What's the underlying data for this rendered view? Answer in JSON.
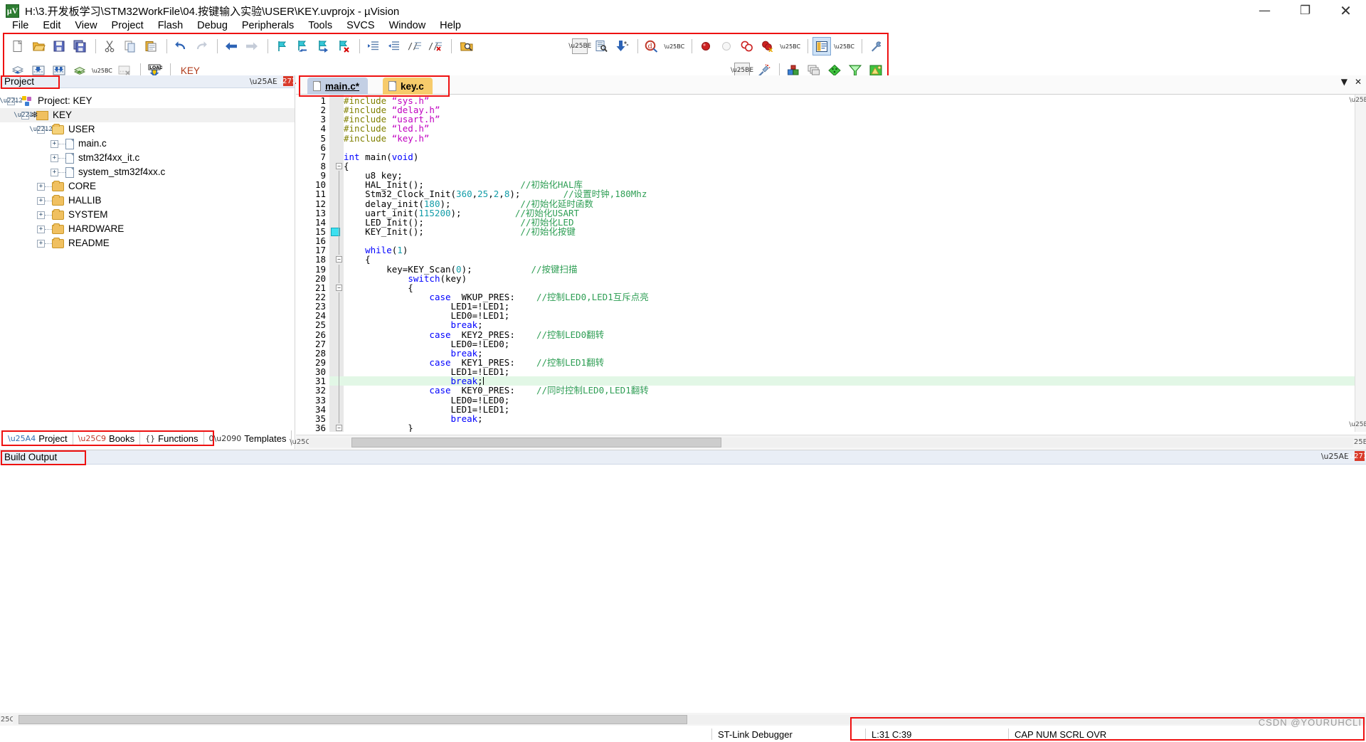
{
  "window": {
    "title": "H:\\3.开发板学习\\STM32WorkFile\\04.按键输入实验\\USER\\KEY.uvprojx - µVision",
    "app_icon": "uvision-logo-icon",
    "controls": {
      "minimize": "—",
      "maximize": "❐",
      "close": "✕"
    }
  },
  "menu": {
    "items": [
      {
        "label": "File"
      },
      {
        "label": "Edit"
      },
      {
        "label": "View"
      },
      {
        "label": "Project"
      },
      {
        "label": "Flash"
      },
      {
        "label": "Debug"
      },
      {
        "label": "Peripherals"
      },
      {
        "label": "Tools"
      },
      {
        "label": "SVCS"
      },
      {
        "label": "Window"
      },
      {
        "label": "Help"
      }
    ]
  },
  "toolbar": {
    "row1": [
      {
        "name": "new-file-icon",
        "tip": "New"
      },
      {
        "name": "open-file-icon",
        "tip": "Open"
      },
      {
        "name": "save-icon",
        "tip": "Save"
      },
      {
        "name": "save-all-icon",
        "tip": "Save All"
      },
      {
        "name": "cut-icon",
        "tip": "Cut"
      },
      {
        "name": "copy-icon",
        "tip": "Copy"
      },
      {
        "name": "paste-icon",
        "tip": "Paste"
      },
      {
        "name": "undo-icon",
        "tip": "Undo"
      },
      {
        "name": "redo-icon",
        "tip": "Redo"
      },
      {
        "name": "navigate-back-icon",
        "tip": "Back"
      },
      {
        "name": "navigate-forward-icon",
        "tip": "Forward"
      },
      {
        "name": "bookmark-toggle-icon",
        "tip": "Insert/Remove Bookmark"
      },
      {
        "name": "bookmark-prev-icon",
        "tip": "Previous Bookmark"
      },
      {
        "name": "bookmark-next-icon",
        "tip": "Next Bookmark"
      },
      {
        "name": "bookmark-clear-icon",
        "tip": "Clear All Bookmarks"
      },
      {
        "name": "indent-right-icon",
        "tip": "Indent"
      },
      {
        "name": "indent-left-icon",
        "tip": "Outdent"
      },
      {
        "name": "comment-icon",
        "tip": "Comment Selection"
      },
      {
        "name": "uncomment-icon",
        "tip": "Uncomment Selection"
      },
      {
        "name": "find-in-files-icon",
        "tip": "Find in Files"
      },
      {
        "name": "combo-dropdown",
        "tip": "Search text"
      },
      {
        "name": "find-icon",
        "tip": "Find"
      },
      {
        "name": "incremental-find-icon",
        "tip": "Incremental Find"
      },
      {
        "name": "browse-symbol-icon",
        "tip": "Browse Symbol"
      },
      {
        "name": "breakpoint-insert-icon",
        "tip": "Insert/Remove Breakpoint"
      },
      {
        "name": "breakpoint-disable-icon",
        "tip": "Enable/Disable Breakpoint"
      },
      {
        "name": "breakpoint-disable-all-icon",
        "tip": "Disable All Breakpoints"
      },
      {
        "name": "breakpoint-kill-all-icon",
        "tip": "Kill All Breakpoints"
      },
      {
        "name": "window-layout-icon",
        "tip": "Configure Windows",
        "selected": true
      },
      {
        "name": "configure-target-icon",
        "tip": "Configuration Wizard"
      }
    ],
    "row2": [
      {
        "name": "build-icon",
        "tip": "Translate"
      },
      {
        "name": "build-target-icon",
        "tip": "Build"
      },
      {
        "name": "rebuild-all-icon",
        "tip": "Rebuild"
      },
      {
        "name": "batch-build-icon",
        "tip": "Batch Build"
      },
      {
        "name": "stop-build-icon",
        "tip": "Stop Build"
      },
      {
        "name": "download-icon",
        "tip": "Download (LOAD)"
      },
      {
        "name": "target-select-combo",
        "tip": "Select Target"
      },
      {
        "name": "target-options-icon",
        "tip": "Options for Target"
      },
      {
        "name": "manage-project-items-icon",
        "tip": "Manage Project Items"
      },
      {
        "name": "multi-project-icon",
        "tip": "Manage Multi-Project Workspace"
      },
      {
        "name": "pack-installer-icon",
        "tip": "Pack Installer"
      },
      {
        "name": "svcs-icon",
        "tip": "Software Packs Filter"
      },
      {
        "name": "manage-run-time-env-icon",
        "tip": "Manage Run-Time Environment"
      }
    ],
    "download_label": "LOAD",
    "target_value": "KEY"
  },
  "project_panel": {
    "title": "Project",
    "pin_icon": "pin-icon",
    "close_icon": "close-icon",
    "tree": [
      {
        "indent": 0,
        "expander": "-",
        "icon": "project-icon",
        "label": "Project: KEY",
        "selected": false
      },
      {
        "indent": 1,
        "expander": "-",
        "icon": "target-icon",
        "label": "KEY",
        "selected": true
      },
      {
        "indent": 2,
        "expander": "-",
        "icon": "folder-open-icon",
        "label": "USER",
        "selected": false
      },
      {
        "indent": 3,
        "expander": "+",
        "icon": "file-icon",
        "label": "main.c",
        "selected": false
      },
      {
        "indent": 3,
        "expander": "+",
        "icon": "file-icon",
        "label": "stm32f4xx_it.c",
        "selected": false
      },
      {
        "indent": 3,
        "expander": "+",
        "icon": "file-icon",
        "label": "system_stm32f4xx.c",
        "selected": false
      },
      {
        "indent": 2,
        "expander": "+",
        "icon": "folder-icon",
        "label": "CORE",
        "selected": false
      },
      {
        "indent": 2,
        "expander": "+",
        "icon": "folder-icon",
        "label": "HALLIB",
        "selected": false
      },
      {
        "indent": 2,
        "expander": "+",
        "icon": "folder-icon",
        "label": "SYSTEM",
        "selected": false
      },
      {
        "indent": 2,
        "expander": "+",
        "icon": "folder-icon",
        "label": "HARDWARE",
        "selected": false
      },
      {
        "indent": 2,
        "expander": "+",
        "icon": "folder-icon",
        "label": "README",
        "selected": false
      }
    ],
    "tabs": [
      {
        "label": "Project",
        "icon": "project-tab-icon",
        "active": true
      },
      {
        "label": "Books",
        "icon": "books-icon",
        "active": false
      },
      {
        "label": "Functions",
        "icon": "functions-braces-icon",
        "active": false
      },
      {
        "label": "Templates",
        "icon": "templates-icon",
        "active": false
      }
    ]
  },
  "editor": {
    "tabs": [
      {
        "label": "main.c*",
        "active": true,
        "icon": "file-icon"
      },
      {
        "label": "key.c",
        "active": false,
        "icon": "file-icon"
      }
    ],
    "first_line": 1,
    "last_line": 36,
    "highlight_line": 31,
    "breakpoint_line": 15,
    "fold_lines": [
      8,
      18,
      21,
      36
    ],
    "lines": [
      {
        "n": 1,
        "tokens": [
          {
            "t": "#include ",
            "c": "pp"
          },
          {
            "t": "“sys.h”",
            "c": "st"
          }
        ]
      },
      {
        "n": 2,
        "tokens": [
          {
            "t": "#include ",
            "c": "pp"
          },
          {
            "t": "“delay.h”",
            "c": "st"
          }
        ]
      },
      {
        "n": 3,
        "tokens": [
          {
            "t": "#include ",
            "c": "pp"
          },
          {
            "t": "“usart.h”",
            "c": "st"
          }
        ]
      },
      {
        "n": 4,
        "tokens": [
          {
            "t": "#include ",
            "c": "pp"
          },
          {
            "t": "“led.h”",
            "c": "st"
          }
        ]
      },
      {
        "n": 5,
        "tokens": [
          {
            "t": "#include ",
            "c": "pp"
          },
          {
            "t": "“key.h”",
            "c": "st"
          }
        ]
      },
      {
        "n": 6,
        "tokens": []
      },
      {
        "n": 7,
        "tokens": [
          {
            "t": "int",
            "c": "k"
          },
          {
            "t": " main(",
            "c": ""
          },
          {
            "t": "void",
            "c": "k"
          },
          {
            "t": ")",
            "c": ""
          }
        ]
      },
      {
        "n": 8,
        "tokens": [
          {
            "t": "{",
            "c": ""
          }
        ]
      },
      {
        "n": 9,
        "tokens": [
          {
            "t": "    u8 key;",
            "c": ""
          }
        ]
      },
      {
        "n": 10,
        "tokens": [
          {
            "t": "    HAL_Init();",
            "c": ""
          },
          {
            "t": "                  ",
            "c": ""
          },
          {
            "t": "//初始化HAL库",
            "c": "cm"
          }
        ]
      },
      {
        "n": 11,
        "tokens": [
          {
            "t": "    Stm32_Clock_Init(",
            "c": ""
          },
          {
            "t": "360",
            "c": "nu"
          },
          {
            "t": ",",
            "c": ""
          },
          {
            "t": "25",
            "c": "nu"
          },
          {
            "t": ",",
            "c": ""
          },
          {
            "t": "2",
            "c": "nu"
          },
          {
            "t": ",",
            "c": ""
          },
          {
            "t": "8",
            "c": "nu"
          },
          {
            "t": ");",
            "c": ""
          },
          {
            "t": "        ",
            "c": ""
          },
          {
            "t": "//设置时钟,180Mhz",
            "c": "cm"
          }
        ]
      },
      {
        "n": 12,
        "tokens": [
          {
            "t": "    delay_init(",
            "c": ""
          },
          {
            "t": "180",
            "c": "nu"
          },
          {
            "t": ");",
            "c": ""
          },
          {
            "t": "             ",
            "c": ""
          },
          {
            "t": "//初始化延时函数",
            "c": "cm"
          }
        ]
      },
      {
        "n": 13,
        "tokens": [
          {
            "t": "    uart_init(",
            "c": ""
          },
          {
            "t": "115200",
            "c": "nu"
          },
          {
            "t": ");",
            "c": ""
          },
          {
            "t": "          ",
            "c": ""
          },
          {
            "t": "//初始化USART",
            "c": "cm"
          }
        ]
      },
      {
        "n": 14,
        "tokens": [
          {
            "t": "    LED_Init();",
            "c": ""
          },
          {
            "t": "                  ",
            "c": ""
          },
          {
            "t": "//初始化LED",
            "c": "cm"
          }
        ]
      },
      {
        "n": 15,
        "tokens": [
          {
            "t": "    KEY_Init();",
            "c": ""
          },
          {
            "t": "                  ",
            "c": ""
          },
          {
            "t": "//初始化按键",
            "c": "cm"
          }
        ]
      },
      {
        "n": 16,
        "tokens": []
      },
      {
        "n": 17,
        "tokens": [
          {
            "t": "    ",
            "c": ""
          },
          {
            "t": "while",
            "c": "k"
          },
          {
            "t": "(",
            "c": ""
          },
          {
            "t": "1",
            "c": "nu"
          },
          {
            "t": ")",
            "c": ""
          }
        ]
      },
      {
        "n": 18,
        "tokens": [
          {
            "t": "    {",
            "c": ""
          }
        ]
      },
      {
        "n": 19,
        "tokens": [
          {
            "t": "        key=KEY_Scan(",
            "c": ""
          },
          {
            "t": "0",
            "c": "nu"
          },
          {
            "t": ");",
            "c": ""
          },
          {
            "t": "           ",
            "c": ""
          },
          {
            "t": "//按键扫描",
            "c": "cm"
          }
        ]
      },
      {
        "n": 20,
        "tokens": [
          {
            "t": "            ",
            "c": ""
          },
          {
            "t": "switch",
            "c": "k"
          },
          {
            "t": "(key)",
            "c": ""
          }
        ]
      },
      {
        "n": 21,
        "tokens": [
          {
            "t": "            {",
            "c": ""
          }
        ]
      },
      {
        "n": 22,
        "tokens": [
          {
            "t": "                ",
            "c": ""
          },
          {
            "t": "case",
            "c": "k"
          },
          {
            "t": "  WKUP_PRES:    ",
            "c": ""
          },
          {
            "t": "//控制LED0,LED1互斥点亮",
            "c": "cm"
          }
        ]
      },
      {
        "n": 23,
        "tokens": [
          {
            "t": "                    LED1=!LED1;",
            "c": ""
          }
        ]
      },
      {
        "n": 24,
        "tokens": [
          {
            "t": "                    LED0=!LED1;",
            "c": ""
          }
        ]
      },
      {
        "n": 25,
        "tokens": [
          {
            "t": "                    ",
            "c": ""
          },
          {
            "t": "break",
            "c": "k"
          },
          {
            "t": ";",
            "c": ""
          }
        ]
      },
      {
        "n": 26,
        "tokens": [
          {
            "t": "                ",
            "c": ""
          },
          {
            "t": "case",
            "c": "k"
          },
          {
            "t": "  KEY2_PRES:    ",
            "c": ""
          },
          {
            "t": "//控制LED0翻转",
            "c": "cm"
          }
        ]
      },
      {
        "n": 27,
        "tokens": [
          {
            "t": "                    LED0=!LED0;",
            "c": ""
          }
        ]
      },
      {
        "n": 28,
        "tokens": [
          {
            "t": "                    ",
            "c": ""
          },
          {
            "t": "break",
            "c": "k"
          },
          {
            "t": ";",
            "c": ""
          }
        ]
      },
      {
        "n": 29,
        "tokens": [
          {
            "t": "                ",
            "c": ""
          },
          {
            "t": "case",
            "c": "k"
          },
          {
            "t": "  KEY1_PRES:    ",
            "c": ""
          },
          {
            "t": "//控制LED1翻转",
            "c": "cm"
          }
        ]
      },
      {
        "n": 30,
        "tokens": [
          {
            "t": "                    LED1=!LED1;",
            "c": ""
          }
        ]
      },
      {
        "n": 31,
        "tokens": [
          {
            "t": "                    ",
            "c": ""
          },
          {
            "t": "break",
            "c": "k"
          },
          {
            "t": ";",
            "c": ""
          }
        ],
        "highlight": true,
        "cursor": true
      },
      {
        "n": 32,
        "tokens": [
          {
            "t": "                ",
            "c": ""
          },
          {
            "t": "case",
            "c": "k"
          },
          {
            "t": "  KEY0_PRES:    ",
            "c": ""
          },
          {
            "t": "//同时控制LED0,LED1翻转",
            "c": "cm"
          }
        ]
      },
      {
        "n": 33,
        "tokens": [
          {
            "t": "                    LED0=!LED0;",
            "c": ""
          }
        ]
      },
      {
        "n": 34,
        "tokens": [
          {
            "t": "                    LED1=!LED1;",
            "c": ""
          }
        ]
      },
      {
        "n": 35,
        "tokens": [
          {
            "t": "                    ",
            "c": ""
          },
          {
            "t": "break",
            "c": "k"
          },
          {
            "t": ";",
            "c": ""
          }
        ]
      },
      {
        "n": 36,
        "tokens": [
          {
            "t": "            }",
            "c": ""
          }
        ]
      }
    ],
    "dock_controls": {
      "dropdown": "▼",
      "close": "✕"
    }
  },
  "build_output": {
    "title": "Build Output",
    "pin_icon": "pin-icon",
    "close_icon": "close-icon",
    "content": ""
  },
  "statusbar": {
    "debugger": "ST-Link Debugger",
    "position": "L:31 C:39",
    "indicators": "CAP NUM SCRL OVR",
    "watermark": "CSDN @YOURUHCLI"
  },
  "colors": {
    "highlight_red": "#ee1111",
    "keyword": "#0000ff",
    "preprocessor": "#808000",
    "string": "#c000c0",
    "comment": "#2e9e54",
    "number": "#119ca8",
    "tab_active": "#c3cfe4",
    "tab_inactive": "#f7cb6b",
    "line_highlight": "#e2f7e6",
    "breakpoint": "#3de0f0"
  }
}
